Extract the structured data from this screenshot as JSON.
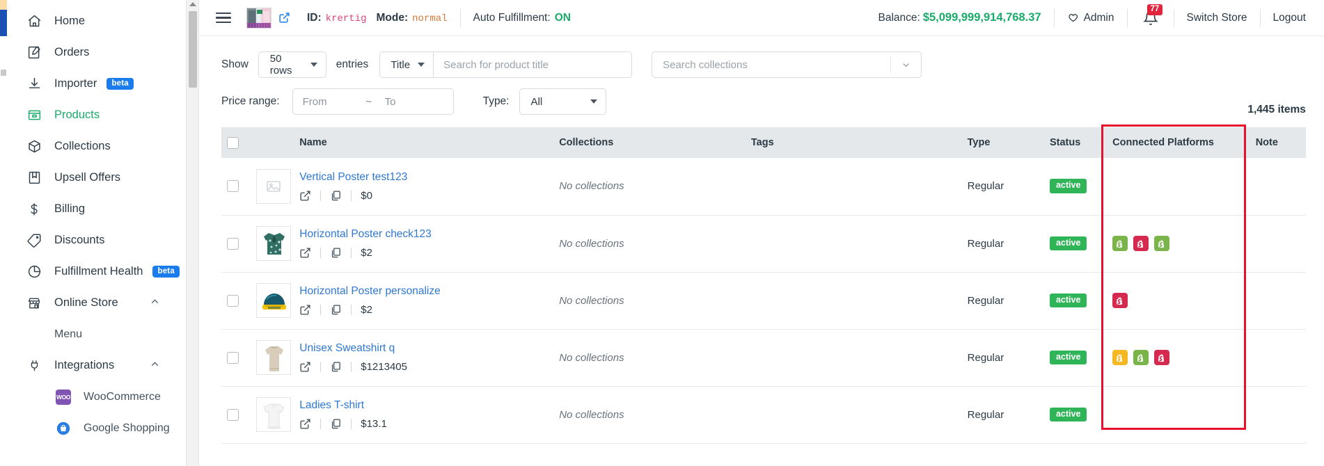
{
  "sidebar": {
    "items": [
      {
        "label": "Home",
        "icon": "home-icon",
        "badge": null,
        "active": false,
        "chevron": null
      },
      {
        "label": "Orders",
        "icon": "orders-pencil-icon",
        "badge": null,
        "active": false,
        "chevron": null
      },
      {
        "label": "Importer",
        "icon": "download-icon",
        "badge": "beta",
        "active": false,
        "chevron": null
      },
      {
        "label": "Products",
        "icon": "products-box-icon",
        "badge": null,
        "active": true,
        "chevron": null
      },
      {
        "label": "Collections",
        "icon": "collections-cube-icon",
        "badge": null,
        "active": false,
        "chevron": null
      },
      {
        "label": "Upsell Offers",
        "icon": "bookmark-icon",
        "badge": null,
        "active": false,
        "chevron": null
      },
      {
        "label": "Billing",
        "icon": "dollar-icon",
        "badge": null,
        "active": false,
        "chevron": null
      },
      {
        "label": "Discounts",
        "icon": "tag-icon",
        "badge": null,
        "active": false,
        "chevron": null
      },
      {
        "label": "Fulfillment Health",
        "icon": "pie-chart-icon",
        "badge": "beta",
        "active": false,
        "chevron": null
      },
      {
        "label": "Online Store",
        "icon": "storefront-icon",
        "badge": null,
        "active": false,
        "chevron": "up"
      },
      {
        "label": "Menu",
        "icon": null,
        "badge": null,
        "active": false,
        "chevron": null,
        "sub": true
      },
      {
        "label": "Integrations",
        "icon": "plug-icon",
        "badge": null,
        "active": false,
        "chevron": "up"
      },
      {
        "label": "WooCommerce",
        "icon": "woocommerce-icon",
        "badge": null,
        "active": false,
        "chevron": null,
        "sub": true
      },
      {
        "label": "Google Shopping",
        "icon": "google-shopping-icon",
        "badge": null,
        "active": false,
        "chevron": null,
        "sub": true
      }
    ]
  },
  "topbar": {
    "id_label": "ID:",
    "id_value": "krertig",
    "mode_label": "Mode:",
    "mode_value": "normal",
    "auto_fulfillment_label": "Auto Fulfillment:",
    "auto_fulfillment_value": "ON",
    "balance_label": "Balance:",
    "balance_value": "$5,099,999,914,768.37",
    "admin_label": "Admin",
    "notification_count": "77",
    "switch_store_label": "Switch Store",
    "logout_label": "Logout"
  },
  "filters": {
    "show_label": "Show",
    "rows_value": "50 rows",
    "entries_label": "entries",
    "search_field_value": "Title",
    "search_placeholder": "Search for product title",
    "search_value": "",
    "collections_placeholder": "Search collections",
    "collections_value": "",
    "price_range_label": "Price range:",
    "price_from_placeholder": "From",
    "price_from_value": "",
    "price_tilde": "~",
    "price_to_placeholder": "To",
    "price_to_value": "",
    "type_label": "Type:",
    "type_value": "All",
    "items_count": "1,445 items"
  },
  "table": {
    "columns": [
      "",
      "",
      "Name",
      "Collections",
      "Tags",
      "Type",
      "Status",
      "Connected Platforms",
      "Note"
    ],
    "rows": [
      {
        "name": "Vertical Poster test123",
        "collections": "No collections",
        "tags": "",
        "type": "Regular",
        "status": "active",
        "price": "$0",
        "thumb": "placeholder-image-icon",
        "platforms": [],
        "note": ""
      },
      {
        "name": "Horizontal Poster check123",
        "collections": "No collections",
        "tags": "",
        "type": "Regular",
        "status": "active",
        "price": "$2",
        "thumb": "hawaiian-shirt",
        "platforms": [
          "green",
          "crimson",
          "green"
        ],
        "note": ""
      },
      {
        "name": "Horizontal Poster personalize",
        "collections": "No collections",
        "tags": "",
        "type": "Regular",
        "status": "active",
        "price": "$2",
        "thumb": "baseball-cap",
        "platforms": [
          "crimson"
        ],
        "note": ""
      },
      {
        "name": "Unisex Sweatshirt q",
        "collections": "No collections",
        "tags": "",
        "type": "Regular",
        "status": "active",
        "price": "$1213405",
        "thumb": "sweatshirt",
        "platforms": [
          "yellow",
          "green",
          "crimson"
        ],
        "note": ""
      },
      {
        "name": "Ladies T-shirt",
        "collections": "No collections",
        "tags": "",
        "type": "Regular",
        "status": "active",
        "price": "$13.1",
        "thumb": "tshirt",
        "platforms": [],
        "note": ""
      }
    ]
  },
  "colors": {
    "accent_green": "#1aab6b",
    "link_blue": "#2e78d2",
    "badge_blue": "#1b7ced",
    "status_green": "#2fb457",
    "notification_red": "#e0253c",
    "highlight_red": "#e8112d",
    "shopify_green": "#7ab44a",
    "shopify_crimson": "#d6294f",
    "shopify_yellow": "#f5b722"
  }
}
